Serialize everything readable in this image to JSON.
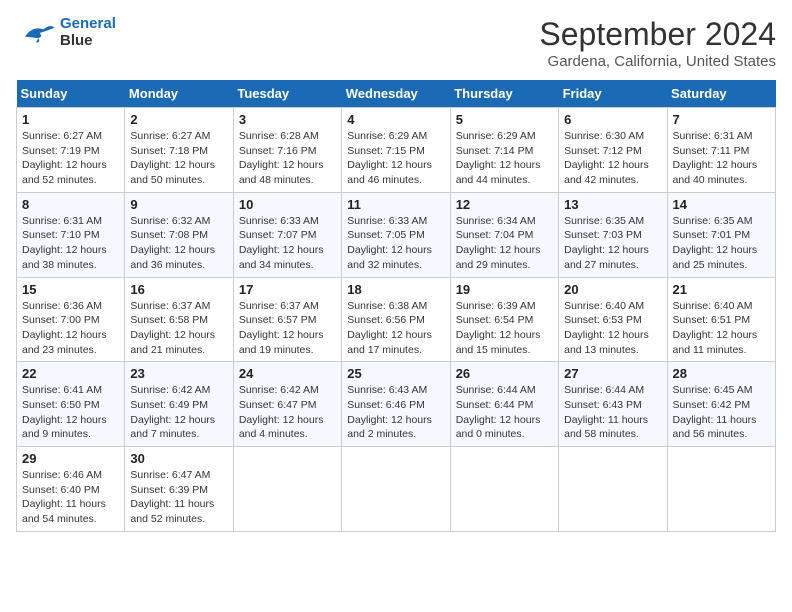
{
  "header": {
    "logo_line1": "General",
    "logo_line2": "Blue",
    "title": "September 2024",
    "subtitle": "Gardena, California, United States"
  },
  "days_of_week": [
    "Sunday",
    "Monday",
    "Tuesday",
    "Wednesday",
    "Thursday",
    "Friday",
    "Saturday"
  ],
  "weeks": [
    [
      {
        "day": "1",
        "info": "Sunrise: 6:27 AM\nSunset: 7:19 PM\nDaylight: 12 hours\nand 52 minutes."
      },
      {
        "day": "2",
        "info": "Sunrise: 6:27 AM\nSunset: 7:18 PM\nDaylight: 12 hours\nand 50 minutes."
      },
      {
        "day": "3",
        "info": "Sunrise: 6:28 AM\nSunset: 7:16 PM\nDaylight: 12 hours\nand 48 minutes."
      },
      {
        "day": "4",
        "info": "Sunrise: 6:29 AM\nSunset: 7:15 PM\nDaylight: 12 hours\nand 46 minutes."
      },
      {
        "day": "5",
        "info": "Sunrise: 6:29 AM\nSunset: 7:14 PM\nDaylight: 12 hours\nand 44 minutes."
      },
      {
        "day": "6",
        "info": "Sunrise: 6:30 AM\nSunset: 7:12 PM\nDaylight: 12 hours\nand 42 minutes."
      },
      {
        "day": "7",
        "info": "Sunrise: 6:31 AM\nSunset: 7:11 PM\nDaylight: 12 hours\nand 40 minutes."
      }
    ],
    [
      {
        "day": "8",
        "info": "Sunrise: 6:31 AM\nSunset: 7:10 PM\nDaylight: 12 hours\nand 38 minutes."
      },
      {
        "day": "9",
        "info": "Sunrise: 6:32 AM\nSunset: 7:08 PM\nDaylight: 12 hours\nand 36 minutes."
      },
      {
        "day": "10",
        "info": "Sunrise: 6:33 AM\nSunset: 7:07 PM\nDaylight: 12 hours\nand 34 minutes."
      },
      {
        "day": "11",
        "info": "Sunrise: 6:33 AM\nSunset: 7:05 PM\nDaylight: 12 hours\nand 32 minutes."
      },
      {
        "day": "12",
        "info": "Sunrise: 6:34 AM\nSunset: 7:04 PM\nDaylight: 12 hours\nand 29 minutes."
      },
      {
        "day": "13",
        "info": "Sunrise: 6:35 AM\nSunset: 7:03 PM\nDaylight: 12 hours\nand 27 minutes."
      },
      {
        "day": "14",
        "info": "Sunrise: 6:35 AM\nSunset: 7:01 PM\nDaylight: 12 hours\nand 25 minutes."
      }
    ],
    [
      {
        "day": "15",
        "info": "Sunrise: 6:36 AM\nSunset: 7:00 PM\nDaylight: 12 hours\nand 23 minutes."
      },
      {
        "day": "16",
        "info": "Sunrise: 6:37 AM\nSunset: 6:58 PM\nDaylight: 12 hours\nand 21 minutes."
      },
      {
        "day": "17",
        "info": "Sunrise: 6:37 AM\nSunset: 6:57 PM\nDaylight: 12 hours\nand 19 minutes."
      },
      {
        "day": "18",
        "info": "Sunrise: 6:38 AM\nSunset: 6:56 PM\nDaylight: 12 hours\nand 17 minutes."
      },
      {
        "day": "19",
        "info": "Sunrise: 6:39 AM\nSunset: 6:54 PM\nDaylight: 12 hours\nand 15 minutes."
      },
      {
        "day": "20",
        "info": "Sunrise: 6:40 AM\nSunset: 6:53 PM\nDaylight: 12 hours\nand 13 minutes."
      },
      {
        "day": "21",
        "info": "Sunrise: 6:40 AM\nSunset: 6:51 PM\nDaylight: 12 hours\nand 11 minutes."
      }
    ],
    [
      {
        "day": "22",
        "info": "Sunrise: 6:41 AM\nSunset: 6:50 PM\nDaylight: 12 hours\nand 9 minutes."
      },
      {
        "day": "23",
        "info": "Sunrise: 6:42 AM\nSunset: 6:49 PM\nDaylight: 12 hours\nand 7 minutes."
      },
      {
        "day": "24",
        "info": "Sunrise: 6:42 AM\nSunset: 6:47 PM\nDaylight: 12 hours\nand 4 minutes."
      },
      {
        "day": "25",
        "info": "Sunrise: 6:43 AM\nSunset: 6:46 PM\nDaylight: 12 hours\nand 2 minutes."
      },
      {
        "day": "26",
        "info": "Sunrise: 6:44 AM\nSunset: 6:44 PM\nDaylight: 12 hours\nand 0 minutes."
      },
      {
        "day": "27",
        "info": "Sunrise: 6:44 AM\nSunset: 6:43 PM\nDaylight: 11 hours\nand 58 minutes."
      },
      {
        "day": "28",
        "info": "Sunrise: 6:45 AM\nSunset: 6:42 PM\nDaylight: 11 hours\nand 56 minutes."
      }
    ],
    [
      {
        "day": "29",
        "info": "Sunrise: 6:46 AM\nSunset: 6:40 PM\nDaylight: 11 hours\nand 54 minutes."
      },
      {
        "day": "30",
        "info": "Sunrise: 6:47 AM\nSunset: 6:39 PM\nDaylight: 11 hours\nand 52 minutes."
      },
      null,
      null,
      null,
      null,
      null
    ]
  ]
}
